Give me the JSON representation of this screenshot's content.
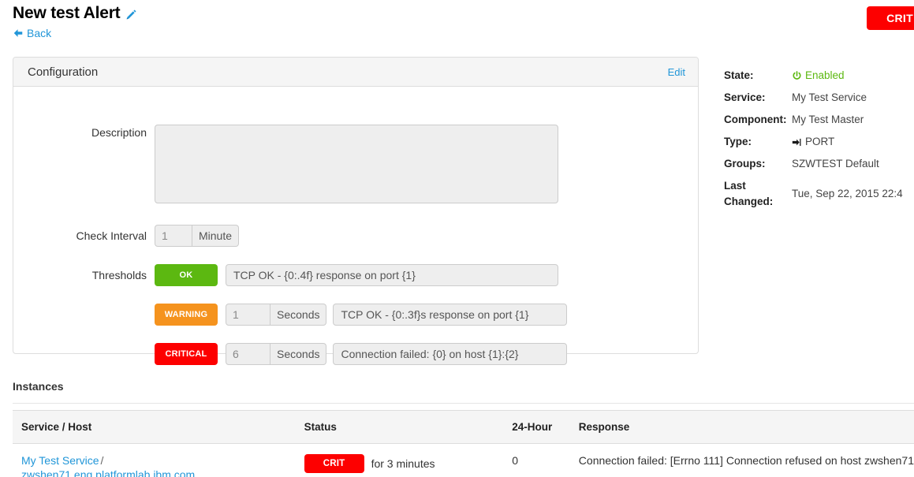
{
  "header": {
    "title": "New test Alert",
    "edit_title_icon": "pencil-icon",
    "back_label": "Back",
    "back_icon": "arrow-left-icon",
    "status_badge": "CRIT"
  },
  "configuration": {
    "panel_title": "Configuration",
    "edit_label": "Edit",
    "description": {
      "label": "Description",
      "value": "",
      "placeholder": ""
    },
    "check_interval": {
      "label": "Check Interval",
      "value": "1",
      "unit": "Minute"
    },
    "thresholds": {
      "label": "Thresholds",
      "rows": [
        {
          "severity": "OK",
          "color": "#5cb811",
          "value": "",
          "unit": "",
          "message": "TCP OK - {0:.4f} response on port {1}"
        },
        {
          "severity": "WARNING",
          "color": "#f5931e",
          "value": "1",
          "unit": "Seconds",
          "message": "TCP OK - {0:.3f}s response on port {1}"
        },
        {
          "severity": "CRITICAL",
          "color": "#fd0000",
          "value": "6",
          "unit": "Seconds",
          "message": "Connection failed: {0} on host {1}:{2}"
        }
      ]
    }
  },
  "meta": {
    "state": {
      "key": "State:",
      "value": "Enabled",
      "icon": "power-icon",
      "color": "#5cb811"
    },
    "service": {
      "key": "Service:",
      "value": "My Test Service"
    },
    "component": {
      "key": "Component:",
      "value": "My Test Master"
    },
    "type": {
      "key": "Type:",
      "value": "PORT",
      "icon": "sign-in-icon"
    },
    "groups": {
      "key": "Groups:",
      "value": "SZWTEST Default"
    },
    "last_changed": {
      "key": "Last Changed:",
      "value": "Tue, Sep 22, 2015 22:4"
    }
  },
  "instances": {
    "title": "Instances",
    "columns": [
      "Service / Host",
      "Status",
      "24-Hour",
      "Response"
    ],
    "rows": [
      {
        "service": "My Test Service",
        "separator": "/",
        "host": "zwshen71.eng.platformlab.ibm.com",
        "status_badge": "CRIT",
        "status_since": "for 3 minutes",
        "twenty_four_hour": "0",
        "response": "Connection failed: [Errno 111] Connection refused on host zwshen71"
      }
    ]
  }
}
